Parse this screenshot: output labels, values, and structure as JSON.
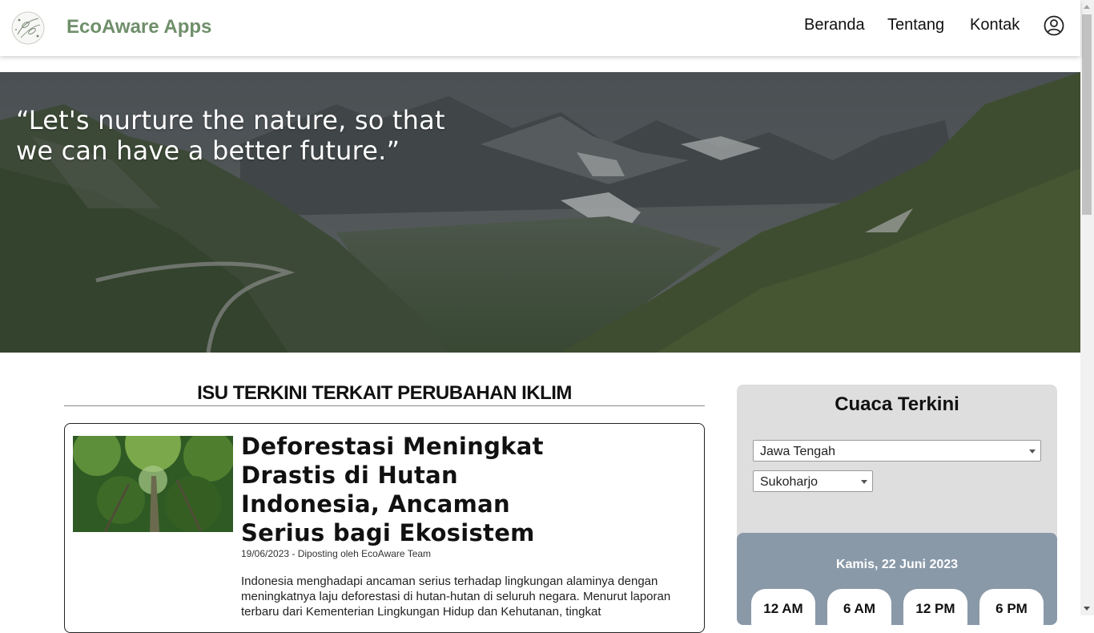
{
  "header": {
    "brand": "EcoAware Apps",
    "nav": [
      {
        "label": "Beranda"
      },
      {
        "label": "Tentang"
      },
      {
        "label": "Kontak"
      }
    ],
    "user_icon": "user-circle-icon"
  },
  "hero": {
    "quote": "“Let's nurture the nature, so that we can have a better future.”"
  },
  "main": {
    "section_title": "ISU TERKINI TERKAIT PERUBAHAN IKLIM",
    "article": {
      "title": "Deforestasi Meningkat Drastis di Hutan Indonesia, Ancaman Serius bagi Ekosistem",
      "meta": "19/06/2023 - Diposting oleh EcoAware Team",
      "excerpt": "Indonesia menghadapi ancaman serius terhadap lingkungan alaminya dengan meningkatnya laju deforestasi di hutan-hutan di seluruh negara. Menurut laporan terbaru dari Kementerian Lingkungan Hidup dan Kehutanan, tingkat"
    }
  },
  "weather": {
    "title": "Cuaca Terkini",
    "province": "Jawa Tengah",
    "regency": "Sukoharjo",
    "date": "Kamis, 22 Juni 2023",
    "times": [
      "12 AM",
      "6 AM",
      "12 PM",
      "6 PM"
    ]
  },
  "colors": {
    "brand": "#6f8f6a",
    "weather_panel": "#dedede",
    "forecast_box": "#8a99a8"
  }
}
